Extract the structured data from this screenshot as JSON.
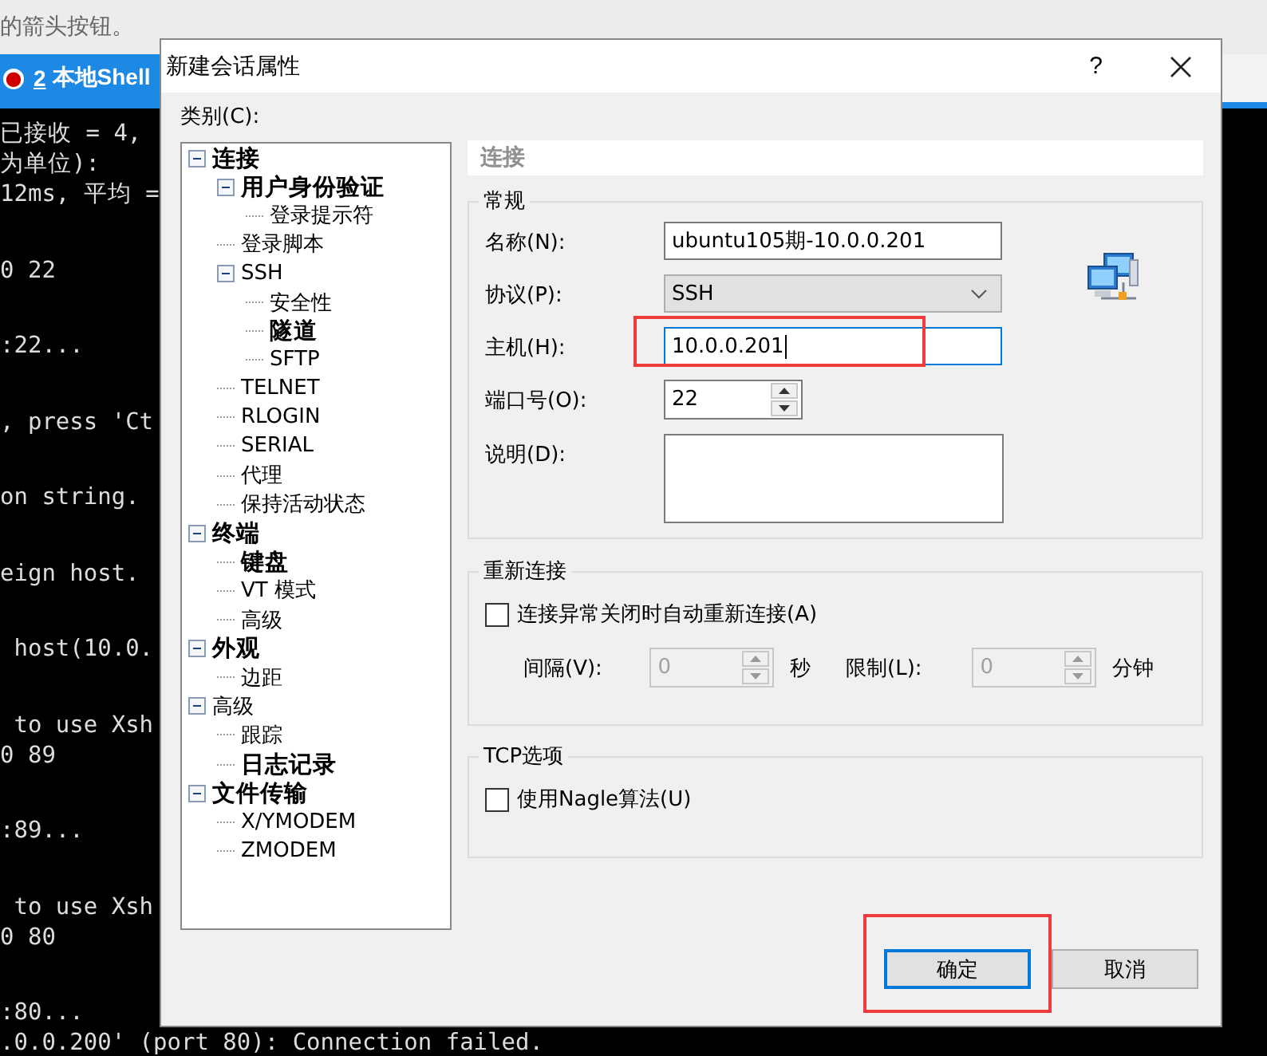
{
  "hint_bar": {
    "text": "的箭头按钮。"
  },
  "session_tab": {
    "marker": "●",
    "number": "2",
    "label": "本地Shell",
    "selected": true
  },
  "terminal": {
    "blocks": [
      [
        "已接收 = 4,",
        "为单位):",
        "12ms, 平均 ="
      ],
      [
        "0 22"
      ],
      [
        ":22..."
      ],
      [
        ", press 'Ct"
      ],
      [
        "on string."
      ],
      [
        "eign host."
      ],
      [
        " host(10.0."
      ],
      [
        " to use Xsh",
        "0 89"
      ],
      [
        ":89..."
      ],
      [
        " to use Xsh",
        "0 80"
      ],
      [
        ":80...",
        ".0.0.200' (port 80): Connection failed."
      ]
    ]
  },
  "dialog": {
    "title": "新建会话属性",
    "help": "?",
    "category_label": "类别(C):",
    "tree": [
      {
        "label": "连接",
        "bold": true,
        "expanded": true,
        "children": [
          {
            "label": "用户身份验证",
            "bold": true,
            "expanded": true,
            "children": [
              {
                "label": "登录提示符",
                "bold": false
              }
            ]
          },
          {
            "label": "登录脚本",
            "bold": false
          },
          {
            "label": "SSH",
            "bold": false,
            "expanded": true,
            "children": [
              {
                "label": "安全性",
                "bold": false
              },
              {
                "label": "隧道",
                "bold": true
              },
              {
                "label": "SFTP",
                "bold": false
              }
            ]
          },
          {
            "label": "TELNET",
            "bold": false
          },
          {
            "label": "RLOGIN",
            "bold": false
          },
          {
            "label": "SERIAL",
            "bold": false
          },
          {
            "label": "代理",
            "bold": false
          },
          {
            "label": "保持活动状态",
            "bold": false
          }
        ]
      },
      {
        "label": "终端",
        "bold": true,
        "expanded": true,
        "children": [
          {
            "label": "键盘",
            "bold": true
          },
          {
            "label": "VT 模式",
            "bold": false
          },
          {
            "label": "高级",
            "bold": false
          }
        ]
      },
      {
        "label": "外观",
        "bold": true,
        "expanded": true,
        "children": [
          {
            "label": "边距",
            "bold": false
          }
        ]
      },
      {
        "label": "高级",
        "bold": false,
        "expanded": true,
        "children": [
          {
            "label": "跟踪",
            "bold": false
          },
          {
            "label": "日志记录",
            "bold": true
          }
        ]
      },
      {
        "label": "文件传输",
        "bold": true,
        "expanded": true,
        "children": [
          {
            "label": "X/YMODEM",
            "bold": false
          },
          {
            "label": "ZMODEM",
            "bold": false
          }
        ]
      }
    ],
    "panel_header": "连接",
    "general": {
      "title": "常规",
      "fields": [
        {
          "kind": "text",
          "label": "名称(N):",
          "value": "ubuntu105期-10.0.0.201",
          "focused": false
        },
        {
          "kind": "select",
          "label": "协议(P):",
          "value": "SSH"
        },
        {
          "kind": "text",
          "label": "主机(H):",
          "value": "10.0.0.201",
          "focused": true
        },
        {
          "kind": "spinner",
          "label": "端口号(O):",
          "value": "22"
        },
        {
          "kind": "textarea",
          "label": "说明(D):"
        }
      ]
    },
    "reconnect": {
      "title": "重新连接",
      "checkbox": {
        "label": "连接异常关闭时自动重新连接(A)",
        "checked": false
      },
      "interval": {
        "label": "间隔(V):",
        "value": "0",
        "unit": "秒",
        "disabled": true
      },
      "limit": {
        "label": "限制(L):",
        "value": "0",
        "unit": "分钟",
        "disabled": true
      }
    },
    "tcp": {
      "title": "TCP选项",
      "checkbox": {
        "label": "使用Nagle算法(U)",
        "checked": false
      }
    },
    "buttons": [
      {
        "label": "确定",
        "default": true
      },
      {
        "label": "取消",
        "default": false
      }
    ]
  }
}
